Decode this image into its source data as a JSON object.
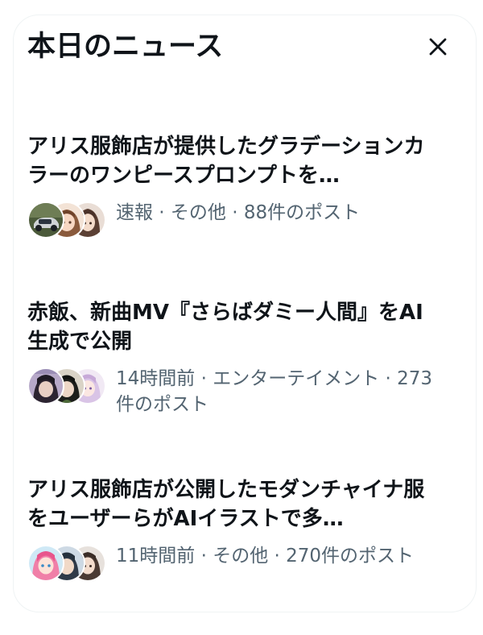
{
  "panel": {
    "title": "本日のニュース",
    "close_icon": "close-icon"
  },
  "news": [
    {
      "headline": "アリス服飾店が提供したグラデーションカラーのワンピースプロンプトを…",
      "meta": "速報 · その他 · 88件のポスト",
      "avatars": [
        "car-photo-avatar",
        "anime-girl-avatar",
        "anime-girl-avatar"
      ]
    },
    {
      "headline": "赤飯、新曲MV『さらばダミー人間』をAI生成で公開",
      "meta": "14時間前 · エンターテイメント · 273件のポスト",
      "avatars": [
        "anime-character-avatar",
        "anime-character-avatar",
        "anime-girl-avatar"
      ]
    },
    {
      "headline": "アリス服飾店が公開したモダンチャイナ服をユーザーらがAIイラストで多…",
      "meta": "11時間前 · その他 · 270件のポスト",
      "avatars": [
        "anime-girl-avatar",
        "anime-boy-avatar",
        "anime-girl-avatar"
      ]
    }
  ],
  "colors": {
    "text_primary": "#0f1419",
    "text_secondary": "#536471",
    "border": "#eff3f4"
  }
}
